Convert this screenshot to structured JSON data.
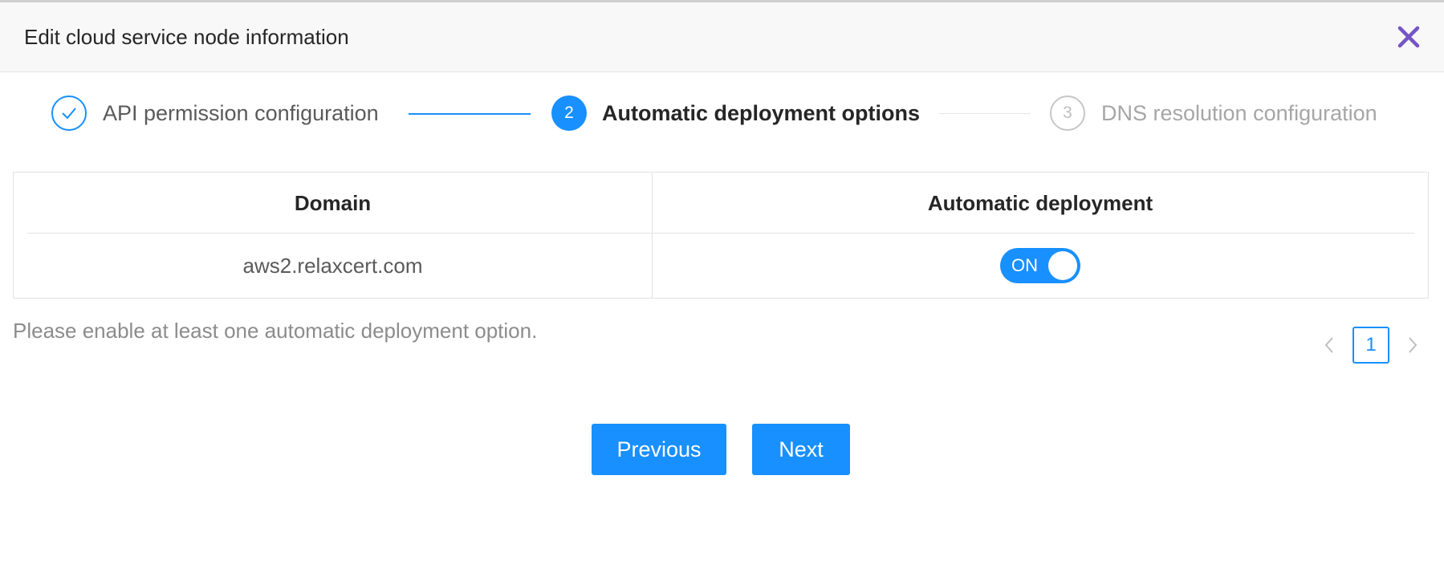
{
  "dialog": {
    "title": "Edit cloud service node information"
  },
  "steps": [
    {
      "label": "API permission configuration",
      "status": "done"
    },
    {
      "label": "Automatic deployment options",
      "status": "active",
      "number": "2"
    },
    {
      "label": "DNS resolution configuration",
      "status": "pending",
      "number": "3"
    }
  ],
  "table": {
    "headers": [
      "Domain",
      "Automatic deployment"
    ],
    "rows": [
      {
        "domain": "aws2.relaxcert.com",
        "auto_deploy": "ON"
      }
    ]
  },
  "hint": "Please enable at least one automatic deployment option.",
  "pagination": {
    "current_page": "1",
    "prev_icon": "chevron-left-icon",
    "next_icon": "chevron-right-icon"
  },
  "buttons": {
    "previous": "Previous",
    "next": "Next"
  },
  "colors": {
    "primary": "#1890ff",
    "close_icon": "#7455c7"
  }
}
